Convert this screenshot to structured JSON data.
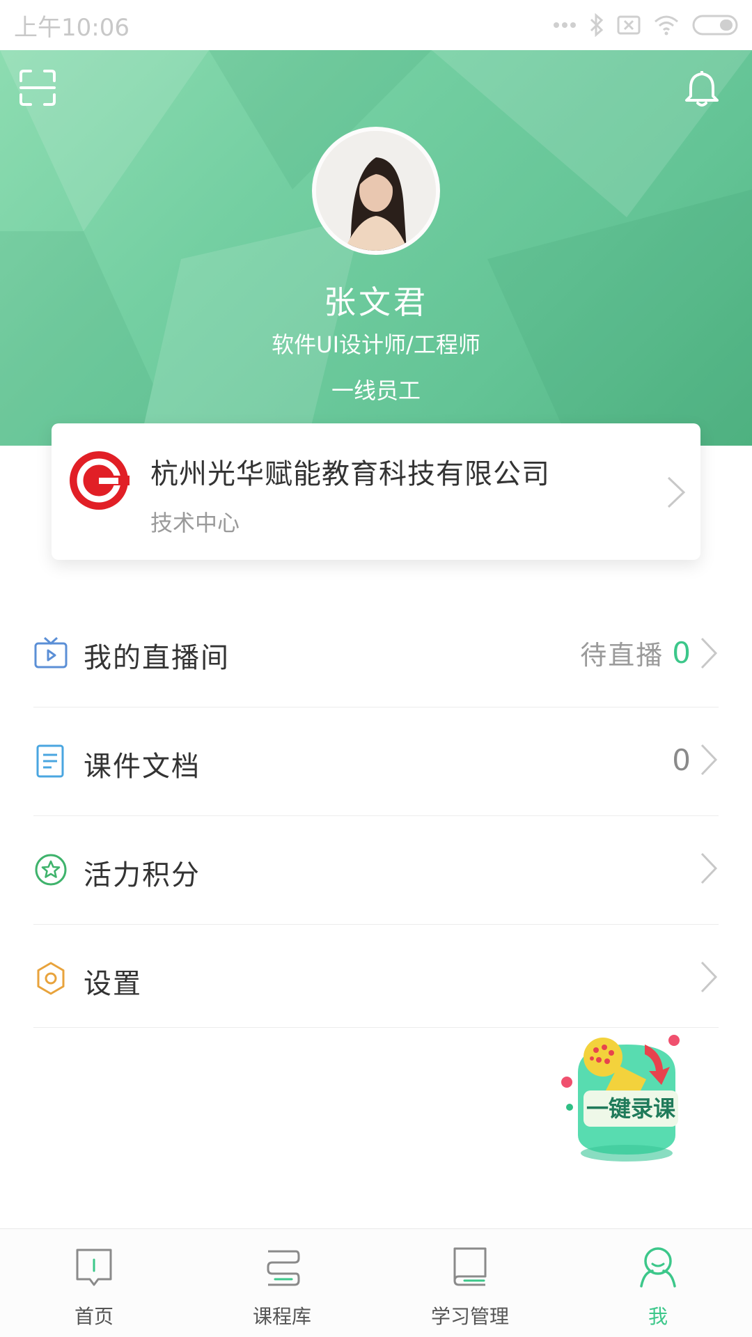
{
  "status_bar": {
    "time": "上午10:06"
  },
  "profile": {
    "name": "张文君",
    "title": "软件UI设计师/工程师",
    "level": "一线员工"
  },
  "company": {
    "name": "杭州光华赋能教育科技有限公司",
    "department": "技术中心"
  },
  "menu": {
    "items": [
      {
        "label": "我的直播间",
        "sub": "待直播",
        "count": "0",
        "icon": "tv-icon",
        "icon_color": "#5b8fd6"
      },
      {
        "label": "课件文档",
        "sub": "",
        "count": "0",
        "icon": "document-icon",
        "icon_color": "#4aa6e0"
      },
      {
        "label": "活力积分",
        "sub": "",
        "count": "",
        "icon": "star-badge-icon",
        "icon_color": "#3fb36c"
      },
      {
        "label": "设置",
        "sub": "",
        "count": "",
        "icon": "gear-icon",
        "icon_color": "#e8a33c"
      }
    ]
  },
  "fab": {
    "label": "一键录课"
  },
  "tabbar": {
    "items": [
      {
        "label": "首页",
        "icon": "home-book-icon"
      },
      {
        "label": "课程库",
        "icon": "library-icon"
      },
      {
        "label": "学习管理",
        "icon": "study-book-icon"
      },
      {
        "label": "我",
        "icon": "person-icon"
      }
    ],
    "active_index": 3
  },
  "colors": {
    "accent": "#3cc78a",
    "hero_start": "#8ddcb1",
    "hero_end": "#53b685"
  }
}
